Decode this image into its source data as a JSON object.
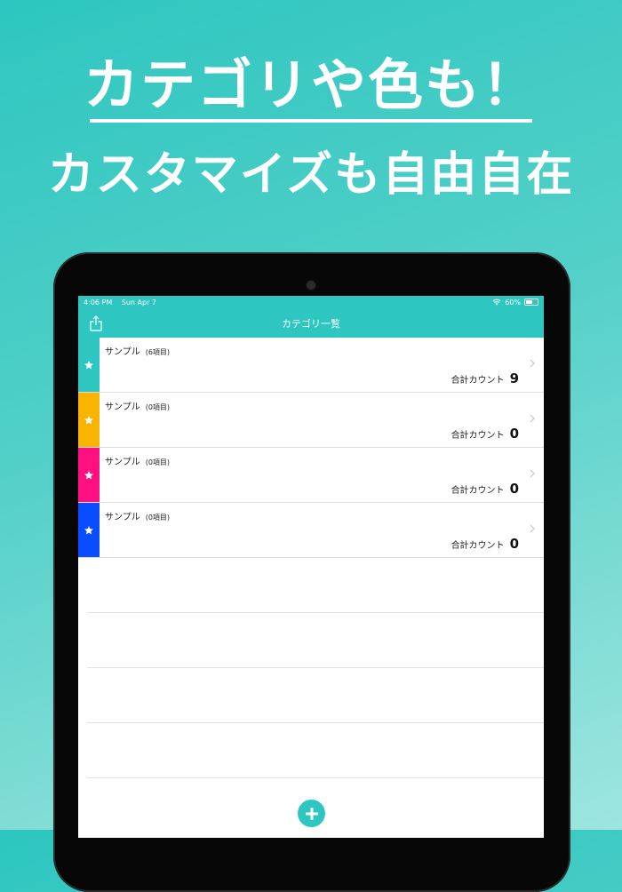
{
  "headline": {
    "line1": "カテゴリや色も！",
    "line2": "カスタマイズも自由自在"
  },
  "status_bar": {
    "time": "4:06 PM",
    "date": "Sun Apr 7",
    "battery": "60%",
    "battery_level": 0.6
  },
  "nav": {
    "title": "カテゴリ一覧",
    "share_icon": "share-icon"
  },
  "categories": [
    {
      "name": "サンプル",
      "count_label": "(6項目)",
      "total_label": "合計カウント",
      "total": "9",
      "color": "#2ec6c0"
    },
    {
      "name": "サンプル",
      "count_label": "(0項目)",
      "total_label": "合計カウント",
      "total": "0",
      "color": "#f8b400"
    },
    {
      "name": "サンプル",
      "count_label": "(0項目)",
      "total_label": "合計カウント",
      "total": "0",
      "color": "#ff0f80"
    },
    {
      "name": "サンプル",
      "count_label": "(0項目)",
      "total_label": "合計カウント",
      "total": "0",
      "color": "#0a4cff"
    }
  ],
  "add_icon": "plus-circle-icon",
  "accent_color": "#2ec6c0"
}
